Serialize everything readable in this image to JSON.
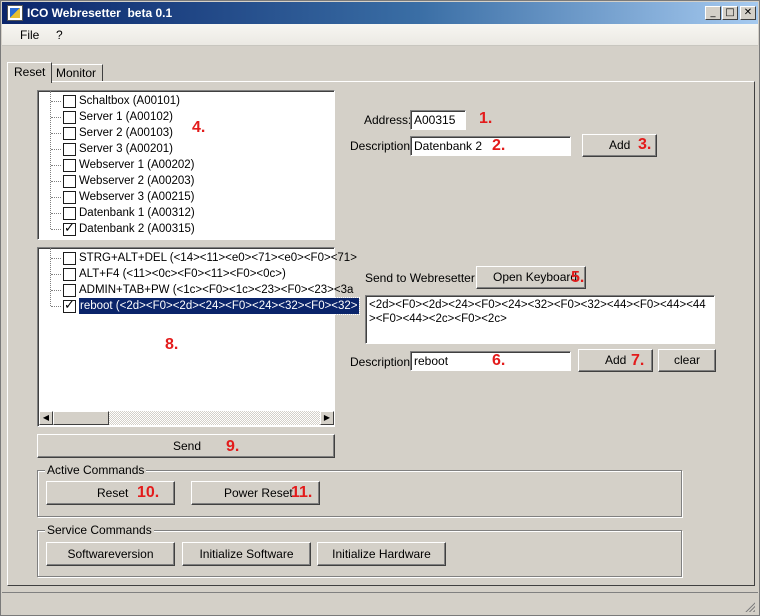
{
  "window": {
    "title": "ICO Webresetter  beta 0.1",
    "minimize": "_",
    "maximize": "□",
    "close": "✕"
  },
  "menu": {
    "file": "File",
    "help": "?"
  },
  "tabs": [
    {
      "label": "Reset"
    },
    {
      "label": "Monitor"
    }
  ],
  "device_tree": {
    "items": [
      {
        "label": "Schaltbox (A00101)",
        "checked": false
      },
      {
        "label": "Server 1 (A00102)",
        "checked": false
      },
      {
        "label": "Server 2 (A00103)",
        "checked": false
      },
      {
        "label": "Server 3 (A00201)",
        "checked": false
      },
      {
        "label": "Webserver 1 (A00202)",
        "checked": false
      },
      {
        "label": "Webserver 2 (A00203)",
        "checked": false
      },
      {
        "label": "Webserver 3 (A00215)",
        "checked": false
      },
      {
        "label": "Datenbank 1 (A00312)",
        "checked": false
      },
      {
        "label": "Datenbank 2 (A00315)",
        "checked": true
      }
    ]
  },
  "command_tree": {
    "items": [
      {
        "label": "STRG+ALT+DEL (<14><11><e0><71><e0><F0><71>",
        "checked": false,
        "selected": false
      },
      {
        "label": "ALT+F4 (<11><0c><F0><11><F0><0c>)",
        "checked": false,
        "selected": false
      },
      {
        "label": "ADMIN+TAB+PW (<1c><F0><1c><23><F0><23><3a",
        "checked": false,
        "selected": false
      },
      {
        "label": "reboot (<2d><F0><2d><24><F0><24><32><F0><32>",
        "checked": true,
        "selected": true
      }
    ]
  },
  "device_form": {
    "address_label": "Address:",
    "address_value": "A00315",
    "description_label": "Description:",
    "description_value": "Datenbank 2",
    "add_label": "Add"
  },
  "command_form": {
    "send_to_label": "Send to Webresetter:",
    "open_keyboard_label": "Open Keyboard",
    "command_text": "<2d><F0><2d><24><F0><24><32><F0><32><44><F0><44><44><F0><44><2c><F0><2c>",
    "description_label": "Description:",
    "description_value": "reboot",
    "add_label": "Add",
    "clear_label": "clear"
  },
  "send_label": "Send",
  "active_commands": {
    "title": "Active Commands",
    "reset_label": "Reset",
    "power_reset_label": "Power Reset"
  },
  "service_commands": {
    "title": "Service Commands",
    "softwareversion_label": "Softwareversion",
    "init_software_label": "Initialize Software",
    "init_hardware_label": "Initialize Hardware"
  },
  "annotations": {
    "a1": "1.",
    "a2": "2.",
    "a3": "3.",
    "a4": "4.",
    "a5": "5.",
    "a6": "6.",
    "a7": "7.",
    "a8": "8.",
    "a9": "9.",
    "a10": "10.",
    "a11": "11."
  },
  "colors": {
    "title_start": "#0a246a",
    "title_end": "#a6caf0",
    "annotation": "#e31b1b",
    "selection": "#0a246a"
  }
}
